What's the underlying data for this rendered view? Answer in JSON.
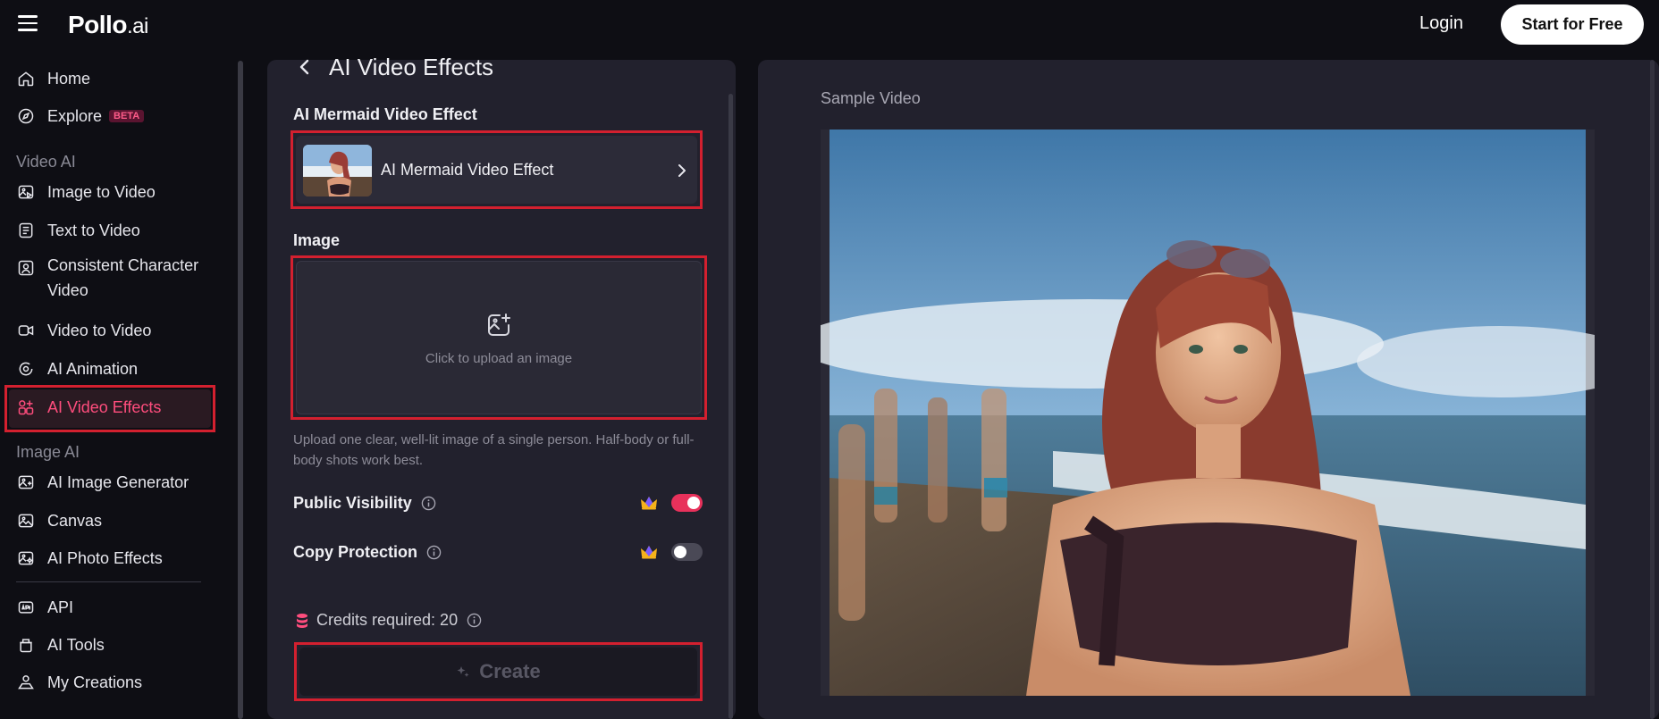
{
  "header": {
    "logo_main": "Pollo",
    "logo_suffix": ".ai",
    "login_label": "Login",
    "start_label": "Start for Free"
  },
  "sidebar": {
    "home": "Home",
    "explore": "Explore",
    "explore_badge": "BETA",
    "section_video": "Video AI",
    "image_to_video": "Image to Video",
    "text_to_video": "Text to Video",
    "consistent_line1": "Consistent Character",
    "consistent_line2": "Video",
    "video_to_video": "Video to Video",
    "ai_animation": "AI Animation",
    "ai_video_effects": "AI Video Effects",
    "section_image": "Image AI",
    "ai_image_generator": "AI Image Generator",
    "canvas": "Canvas",
    "ai_photo_effects": "AI Photo Effects",
    "api": "API",
    "ai_tools": "AI Tools",
    "my_creations": "My Creations"
  },
  "panel": {
    "title": "AI Video Effects",
    "effect_section_label": "AI Mermaid Video Effect",
    "effect_selected": "AI Mermaid Video Effect",
    "image_label": "Image",
    "upload_text": "Click to upload an image",
    "hint": "Upload one clear, well-lit image of a single person. Half-body or full-body shots work best.",
    "public_visibility_label": "Public Visibility",
    "public_visibility_on": true,
    "copy_protection_label": "Copy Protection",
    "copy_protection_on": false,
    "credits_text": "Credits required: 20",
    "create_label": "Create"
  },
  "preview": {
    "sample_label": "Sample Video"
  },
  "colors": {
    "accent": "#ff4d7d",
    "highlight_border": "#d3202f",
    "toggle_on": "#e8315b",
    "toggle_off": "#4a4956"
  }
}
